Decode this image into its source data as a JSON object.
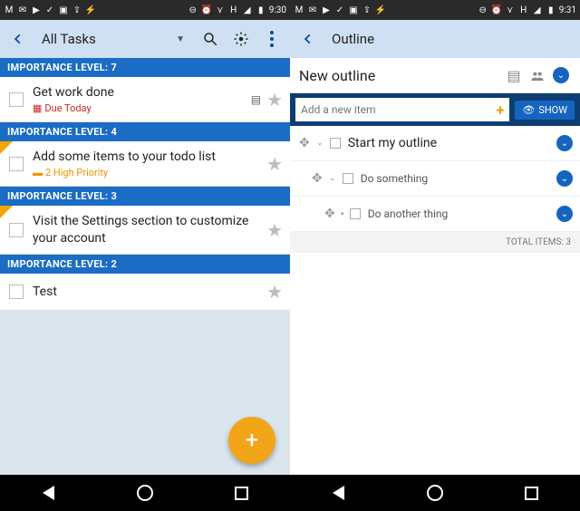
{
  "left": {
    "status": {
      "time": "9:30",
      "net": "H"
    },
    "appbar": {
      "title": "All Tasks"
    },
    "groups": [
      {
        "header": "IMPORTANCE LEVEL: 7",
        "tasks": [
          {
            "title": "Get work done",
            "sub": "Due Today",
            "subColor": "red",
            "corner": false,
            "note": true
          }
        ]
      },
      {
        "header": "IMPORTANCE LEVEL: 4",
        "tasks": [
          {
            "title": "Add some items to your todo list",
            "sub": "2 High Priority",
            "subColor": "orange",
            "corner": true,
            "note": false
          }
        ]
      },
      {
        "header": "IMPORTANCE LEVEL: 3",
        "tasks": [
          {
            "title": "Visit the Settings section to customize your account",
            "sub": "",
            "subColor": "",
            "corner": true,
            "note": false
          }
        ]
      },
      {
        "header": "IMPORTANCE LEVEL: 2",
        "tasks": [
          {
            "title": "Test",
            "sub": "",
            "subColor": "",
            "corner": false,
            "note": false
          }
        ]
      }
    ]
  },
  "right": {
    "status": {
      "time": "9:31",
      "net": "H"
    },
    "appbar": {
      "title": "Outline"
    },
    "outline_title": "New outline",
    "add_placeholder": "Add a new item",
    "show_label": "SHOW",
    "items": [
      {
        "level": 1,
        "label": "Start my outline",
        "expandable": true
      },
      {
        "level": 2,
        "label": "Do something",
        "expandable": true
      },
      {
        "level": 3,
        "label": "Do another thing",
        "expandable": false
      }
    ],
    "total": "TOTAL ITEMS: 3"
  }
}
